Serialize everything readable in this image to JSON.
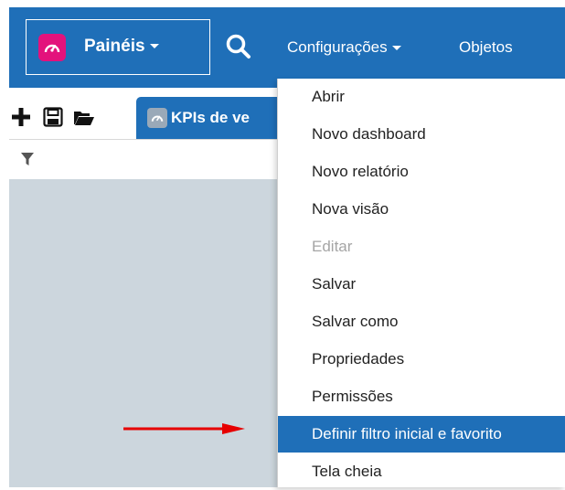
{
  "header": {
    "brand_label": "Painéis",
    "links": [
      {
        "label": "Configurações",
        "has_caret": true
      },
      {
        "label": "Objetos"
      }
    ]
  },
  "tab": {
    "label": "KPIs de ve"
  },
  "menu": {
    "items": [
      {
        "label": "Abrir",
        "state": "normal"
      },
      {
        "label": "Novo dashboard",
        "state": "normal"
      },
      {
        "label": "Novo relatório",
        "state": "normal"
      },
      {
        "label": "Nova visão",
        "state": "normal"
      },
      {
        "label": "Editar",
        "state": "disabled"
      },
      {
        "label": "Salvar",
        "state": "normal"
      },
      {
        "label": "Salvar como",
        "state": "normal"
      },
      {
        "label": "Propriedades",
        "state": "normal"
      },
      {
        "label": "Permissões",
        "state": "normal"
      },
      {
        "label": "Definir filtro inicial e favorito",
        "state": "highlighted"
      },
      {
        "label": "Tela cheia",
        "state": "normal"
      }
    ]
  },
  "icons": {
    "toolbar": [
      "plus-icon",
      "save-icon",
      "folder-open-icon"
    ],
    "filter": "filter-icon",
    "search": "search-icon",
    "logo": "gauge-icon",
    "annotation": "red-arrow-icon"
  },
  "colors": {
    "header_bg": "#1f6fb8",
    "logo_bg": "#e3127c",
    "content_bg": "#ccd6dd",
    "highlight_bg": "#1f6fb8",
    "annotation_arrow": "#e60000"
  }
}
